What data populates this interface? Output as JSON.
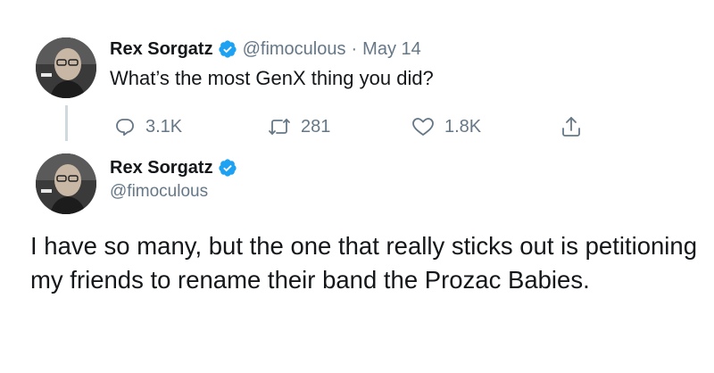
{
  "tweet1": {
    "name": "Rex Sorgatz",
    "handle": "@fimoculous",
    "separator": "·",
    "date": "May 14",
    "text": "What’s the most GenX thing you did?",
    "actions": {
      "replies": "3.1K",
      "retweets": "281",
      "likes": "1.8K"
    }
  },
  "tweet2": {
    "name": "Rex Sorgatz",
    "handle": "@fimoculous",
    "text": "I have so many, but the one that really sticks out is petitioning my friends to rename their band the Prozac Babies."
  },
  "colors": {
    "verified": "#1da1f2",
    "secondary_text": "#657786",
    "primary_text": "#14171a",
    "thread_line": "#cfd9de"
  },
  "icons": [
    "verified-badge-icon",
    "reply-icon",
    "retweet-icon",
    "like-icon",
    "share-icon"
  ]
}
